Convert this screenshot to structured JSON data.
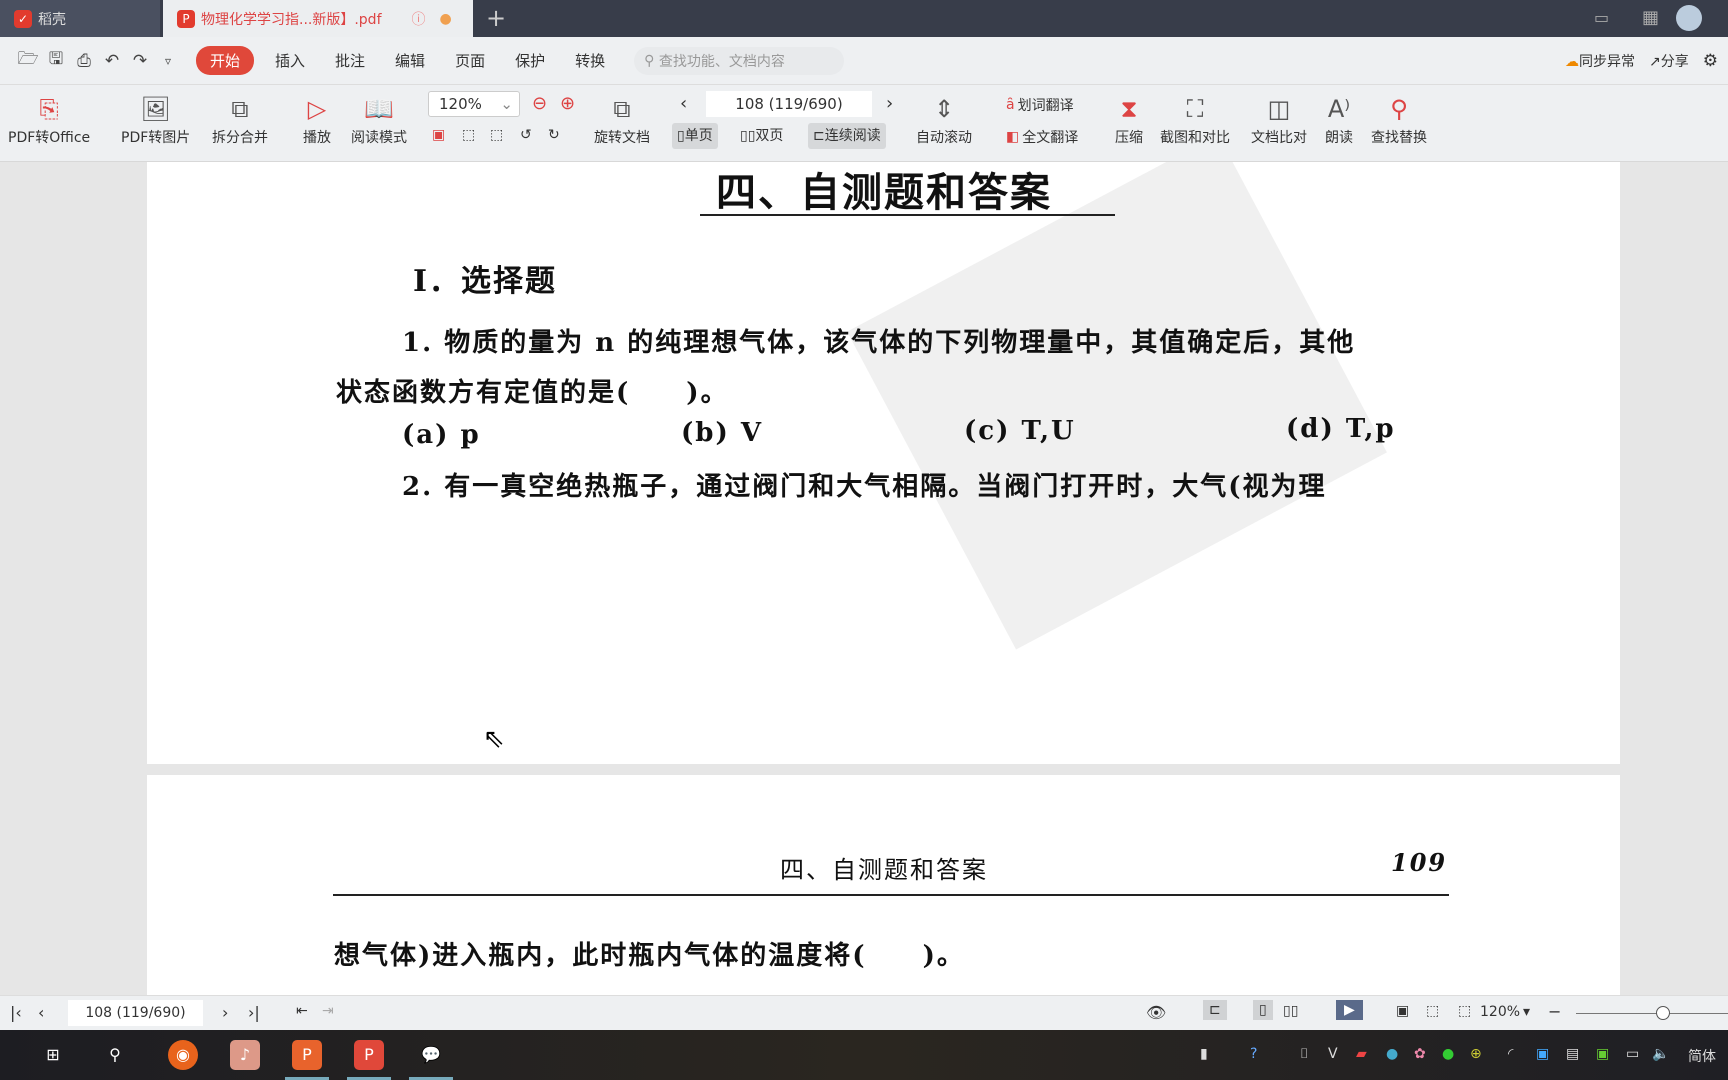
{
  "tabs": [
    {
      "label": "稻壳",
      "icon": "docer-logo-icon"
    },
    {
      "label": "物理化学学习指...新版】.pdf",
      "icon": "pdf-icon"
    }
  ],
  "menu": {
    "items": [
      "开始",
      "插入",
      "批注",
      "编辑",
      "页面",
      "保护",
      "转换"
    ],
    "active": "开始",
    "search_placeholder": "查找功能、文档内容",
    "sync": "同步异常",
    "share": "分享"
  },
  "toolbar": {
    "pdf_to_office": "PDF转Office",
    "pdf_to_image": "PDF转图片",
    "split_merge": "拆分合并",
    "play": "播放",
    "read_mode": "阅读模式",
    "zoom": "120%",
    "rotate": "旋转文档",
    "page": "108 (119/690)",
    "single": "单页",
    "double": "双页",
    "continuous": "连续阅读",
    "auto_scroll": "自动滚动",
    "word_translate": "划词翻译",
    "full_translate": "全文翻译",
    "compress": "压缩",
    "screenshot_compare": "截图和对比",
    "doc_compare": "文档比对",
    "read_aloud": "朗读",
    "find_replace": "查找替换"
  },
  "document": {
    "page1": {
      "heading": "四、自测题和答案",
      "section": "I．选择题",
      "q1_line1": "1. 物质的量为 n 的纯理想气体，该气体的下列物理量中，其值确定后，其他",
      "q1_line2": "状态函数方有定值的是(　　)。",
      "options": [
        "(a) p",
        "(b) V",
        "(c) T,U",
        "(d) T,p"
      ],
      "q2_line1": "2. 有一真空绝热瓶子，通过阀门和大气相隔。当阀门打开时，大气(视为理"
    },
    "page2": {
      "header": "四、自测题和答案",
      "page_number": "109",
      "q2_line2": "想气体)进入瓶内，此时瓶内气体的温度将(　　)。"
    }
  },
  "status": {
    "page": "108 (119/690)",
    "zoom": "120%"
  },
  "taskbar": {
    "ime": "简体"
  },
  "colors": {
    "accent": "#e0483a",
    "tabbar": "#383d4a"
  }
}
